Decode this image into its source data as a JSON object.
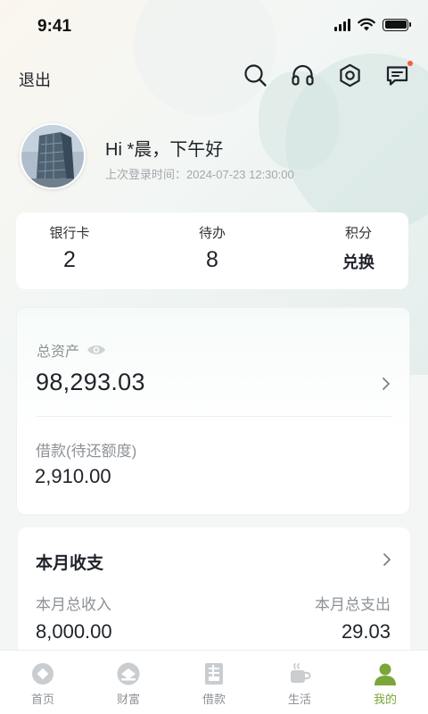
{
  "status_bar": {
    "time": "9:41"
  },
  "header": {
    "logout_label": "退出",
    "icons": [
      "search-icon",
      "headset-icon",
      "settings-icon",
      "message-icon"
    ]
  },
  "profile": {
    "greeting": "Hi *晨，下午好",
    "last_login": "上次登录时间：2024-07-23 12:30:00"
  },
  "stats": [
    {
      "label": "银行卡",
      "value": "2"
    },
    {
      "label": "待办",
      "value": "8"
    },
    {
      "label": "积分",
      "value": "兑换"
    }
  ],
  "assets": {
    "label": "总资产",
    "value": "98,293.03",
    "loan_label": "借款(待还额度)",
    "loan_value": "2,910.00"
  },
  "monthly": {
    "title": "本月收支",
    "income_label": "本月总收入",
    "income_value": "8,000.00",
    "expense_label": "本月总支出",
    "expense_value": "29.03"
  },
  "tabbar": {
    "items": [
      {
        "label": "首页",
        "icon": "home-icon"
      },
      {
        "label": "财富",
        "icon": "wealth-icon"
      },
      {
        "label": "借款",
        "icon": "loan-icon"
      },
      {
        "label": "生活",
        "icon": "life-icon"
      },
      {
        "label": "我的",
        "icon": "profile-icon",
        "active": true
      }
    ],
    "active_color": "#7aa63a",
    "inactive_color": "#c9cdd0"
  },
  "colors": {
    "notification_dot": "#ff5a3c"
  }
}
